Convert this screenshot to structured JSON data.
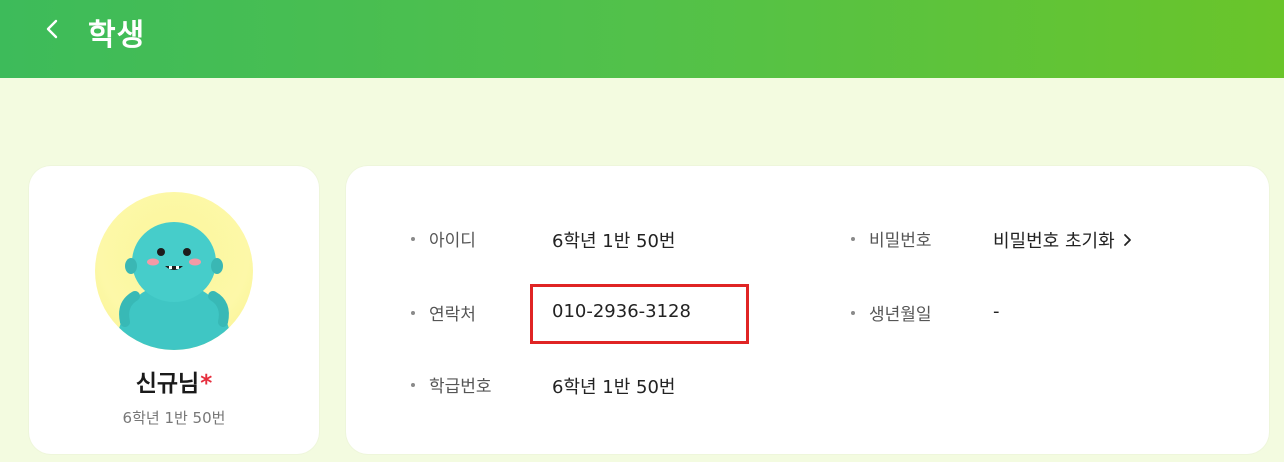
{
  "header": {
    "title": "학생",
    "back_icon": "chevron-left-icon"
  },
  "colors": {
    "header_start": "#3dbb5a",
    "header_end": "#6ac52a",
    "page_background": "#f3fbe0",
    "required_mark": "#e62e3d",
    "highlight_border": "#e02424"
  },
  "profile": {
    "name": "신규님",
    "required_mark": "*",
    "class_info": "6학년 1반 50번",
    "avatar_icon": "character-avatar"
  },
  "info": {
    "fields": [
      {
        "label": "아이디",
        "value": "6학년 1반 50번"
      },
      {
        "label": "비밀번호",
        "value": "비밀번호 초기화"
      },
      {
        "label": "연락처",
        "value": "010-2936-3128"
      },
      {
        "label": "생년월일",
        "value": "-"
      },
      {
        "label": "학급번호",
        "value": "6학년 1반 50번"
      }
    ]
  }
}
